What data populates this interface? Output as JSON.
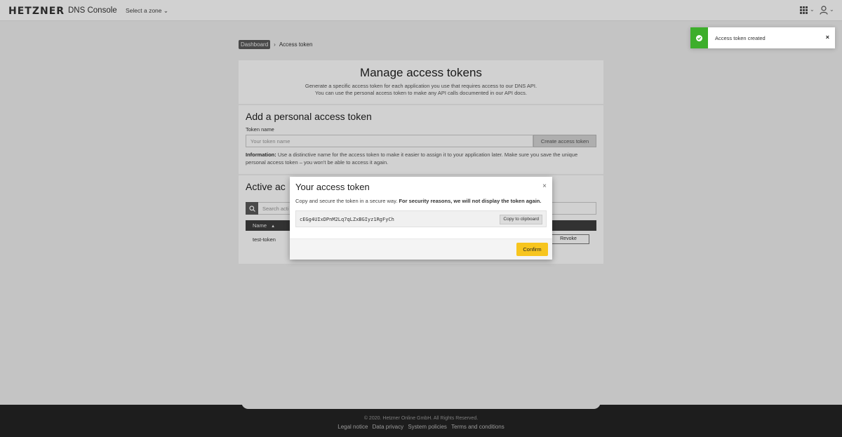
{
  "header": {
    "logo": "HETZNER",
    "app_name": "DNS Console",
    "zone_select": "Select a zone"
  },
  "breadcrumb": {
    "items": [
      "Dashboard",
      "Access token"
    ],
    "separator": "›"
  },
  "manage": {
    "title": "Manage access tokens",
    "description": "Generate a specific access token for each application you use that requires access to our DNS API. You can use the personal access token to make any API calls documented in our API docs."
  },
  "add_token": {
    "title": "Add a personal access token",
    "field_label": "Token name",
    "placeholder": "Your token name",
    "create_button": "Create access token",
    "info_label": "Information:",
    "info_text": "Use a distinctive name for the access token to make it easier to assign it to your application later. Make sure you save the unique personal access token – you won't be able to access it again."
  },
  "active_tokens": {
    "title": "Active ac",
    "search_placeholder": "Search acti",
    "columns": [
      "Name"
    ],
    "sort_icon": "▲",
    "rows": [
      {
        "name": "test-token",
        "action": "Revoke"
      }
    ]
  },
  "modal": {
    "title": "Your access token",
    "close": "×",
    "desc_plain": "Copy and secure the token in a secure way.",
    "desc_bold": "For security reasons, we will not display the token again.",
    "token": "cEGg4UIxDPnM2Lq7qLZxBGIyz1RgFyCh",
    "copy_button": "Copy to clipboard",
    "confirm_button": "Confirm"
  },
  "toast": {
    "message": "Access token created",
    "close": "×"
  },
  "footer": {
    "copyright": "© 2020. Hetzner Online GmbH. All Rights Reserved.",
    "links": [
      "Legal notice",
      "Data privacy",
      "System policies",
      "Terms and conditions"
    ]
  },
  "colors": {
    "accent_yellow": "#f7c51e",
    "success_green": "#3dae2b",
    "footer_bg": "#242424"
  }
}
